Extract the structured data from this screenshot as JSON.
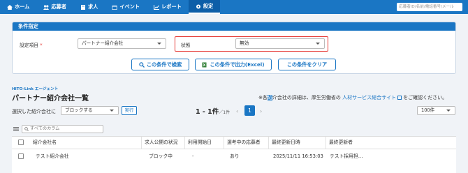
{
  "nav": {
    "items": [
      {
        "label": "ホーム",
        "icon": "home-icon"
      },
      {
        "label": "応募者",
        "icon": "people-icon"
      },
      {
        "label": "求人",
        "icon": "book-icon"
      },
      {
        "label": "イベント",
        "icon": "calendar-icon"
      },
      {
        "label": "レポート",
        "icon": "chart-icon"
      },
      {
        "label": "設定",
        "icon": "gear-icon"
      }
    ],
    "active_index": 5,
    "search_placeholder": "応募者ID/名前/電話番号/メール"
  },
  "condition": {
    "header": "条件指定",
    "setting_label": "設定項目",
    "required_mark": "*",
    "setting_value": "パートナー紹介会社",
    "status_label": "状態",
    "status_value": "無効",
    "search_button": "この条件で検索",
    "export_button": "この条件で出力(Excel)",
    "clear_button": "この条件をクリア"
  },
  "list": {
    "company_tag": "HITO-Link エージェント",
    "title": "パートナー紹介会社一覧",
    "notice_prefix": "※各",
    "notice_highlight": "紹",
    "notice_middle": "介会社の詳細は、厚生労働省の",
    "notice_link": "人材サービス総合サイト",
    "notice_suffix": "をご確認ください。",
    "bulk_label": "選択した紹介会社に",
    "bulk_action": "ブロックする",
    "exec_button": "実行",
    "count_main": "1 - 1件",
    "count_total": "／1件",
    "page_prev": "‹",
    "page_current": "1",
    "page_next": "›",
    "per_page": "100件",
    "column_search_placeholder": "すべてのカラム"
  },
  "table": {
    "columns": [
      "紹介会社名",
      "求人公開の状況",
      "利用開始日",
      "選考中の応募者",
      "最終更新日時",
      "最終更新者"
    ],
    "rows": [
      {
        "name": "テスト紹介会社",
        "status": "ブロック中",
        "start_date": "-",
        "applicants": "あり",
        "updated_at": "2025/11/11 16:53:03",
        "updated_by": "テスト採用担…"
      }
    ]
  },
  "colors": {
    "primary": "#1a76c4",
    "highlight_border": "#e53935",
    "background": "#f0f3f7"
  }
}
